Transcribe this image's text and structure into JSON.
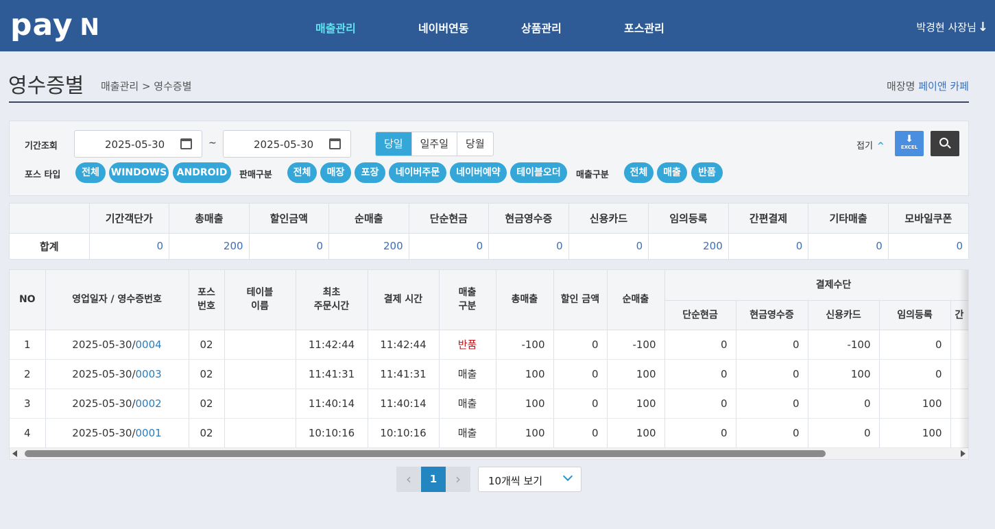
{
  "app": {
    "logo": "pay",
    "logo_n": "N",
    "nav": [
      "매출관리",
      "네이버연동",
      "상품관리",
      "포스관리"
    ],
    "user": "박경현 사장님",
    "user_arrow": "↓"
  },
  "page": {
    "title": "영수증별",
    "breadcrumb": "매출관리 > 영수증별",
    "store_label": "매장명",
    "store_name": "페이앤 카페"
  },
  "filter": {
    "period_label": "기간조회",
    "date_from": "2025-05-30",
    "date_to": "2025-05-30",
    "tilde": "~",
    "ranges": [
      "당일",
      "일주일",
      "당월"
    ],
    "range_selected": "당일",
    "fold_label": "접기",
    "excel_label": "EXCEL",
    "pos_type_label": "포스 타입",
    "pos_types": [
      "전체",
      "WINDOWS",
      "ANDROID"
    ],
    "sale_type_label": "판매구분",
    "sale_types": [
      "전체",
      "매장",
      "포장",
      "네이버주문",
      "네이버예약",
      "테이블오더"
    ],
    "sales_kind_label": "매출구분",
    "sales_kinds": [
      "전체",
      "매출",
      "반품"
    ]
  },
  "summary": {
    "headers": [
      "",
      "기간객단가",
      "총매출",
      "할인금액",
      "순매출",
      "단순현금",
      "현금영수증",
      "신용카드",
      "임의등록",
      "간편결제",
      "기타매출",
      "모바일쿠폰"
    ],
    "row_label": "합계",
    "values": [
      "0",
      "200",
      "0",
      "200",
      "0",
      "0",
      "0",
      "200",
      "0",
      "0",
      "0"
    ]
  },
  "detail": {
    "headers": {
      "no": "NO",
      "date_receipt": "영업일자 / 영수증번호",
      "pos_no_1": "포스",
      "pos_no_2": "번호",
      "table_1": "테이블",
      "table_2": "이름",
      "first_order_1": "최초",
      "first_order_2": "주문시간",
      "pay_time": "결제 시간",
      "sales_type_1": "매출",
      "sales_type_2": "구분",
      "total": "총매출",
      "discount": "할인 금액",
      "net": "순매출",
      "payment_group": "결제수단",
      "cash": "단순현금",
      "cash_receipt": "현금영수증",
      "credit_card": "신용카드",
      "manual": "임의등록",
      "simple_partial": "간"
    },
    "rows": [
      {
        "no": "1",
        "date": "2025-05-30/",
        "receipt": "0004",
        "pos": "02",
        "table": "",
        "first_order": "11:42:44",
        "pay_time": "11:42:44",
        "type": "반품",
        "total": "-100",
        "discount": "0",
        "net": "-100",
        "cash": "0",
        "cash_receipt": "0",
        "credit_card": "-100",
        "manual": "0"
      },
      {
        "no": "2",
        "date": "2025-05-30/",
        "receipt": "0003",
        "pos": "02",
        "table": "",
        "first_order": "11:41:31",
        "pay_time": "11:41:31",
        "type": "매출",
        "total": "100",
        "discount": "0",
        "net": "100",
        "cash": "0",
        "cash_receipt": "0",
        "credit_card": "100",
        "manual": "0"
      },
      {
        "no": "3",
        "date": "2025-05-30/",
        "receipt": "0002",
        "pos": "02",
        "table": "",
        "first_order": "11:40:14",
        "pay_time": "11:40:14",
        "type": "매출",
        "total": "100",
        "discount": "0",
        "net": "100",
        "cash": "0",
        "cash_receipt": "0",
        "credit_card": "0",
        "manual": "100"
      },
      {
        "no": "4",
        "date": "2025-05-30/",
        "receipt": "0001",
        "pos": "02",
        "table": "",
        "first_order": "10:10:16",
        "pay_time": "10:10:16",
        "type": "매출",
        "total": "100",
        "discount": "0",
        "net": "100",
        "cash": "0",
        "cash_receipt": "0",
        "credit_card": "0",
        "manual": "100"
      }
    ]
  },
  "pagination": {
    "prev": "‹",
    "current": "1",
    "next": "›",
    "per_page": "10개씩 보기"
  },
  "colors": {
    "header_bg": "#2e5a96",
    "nav_active": "#5fe3ee",
    "pill": "#35a6d8",
    "link": "#2e7bb6",
    "return": "#c0141b"
  }
}
